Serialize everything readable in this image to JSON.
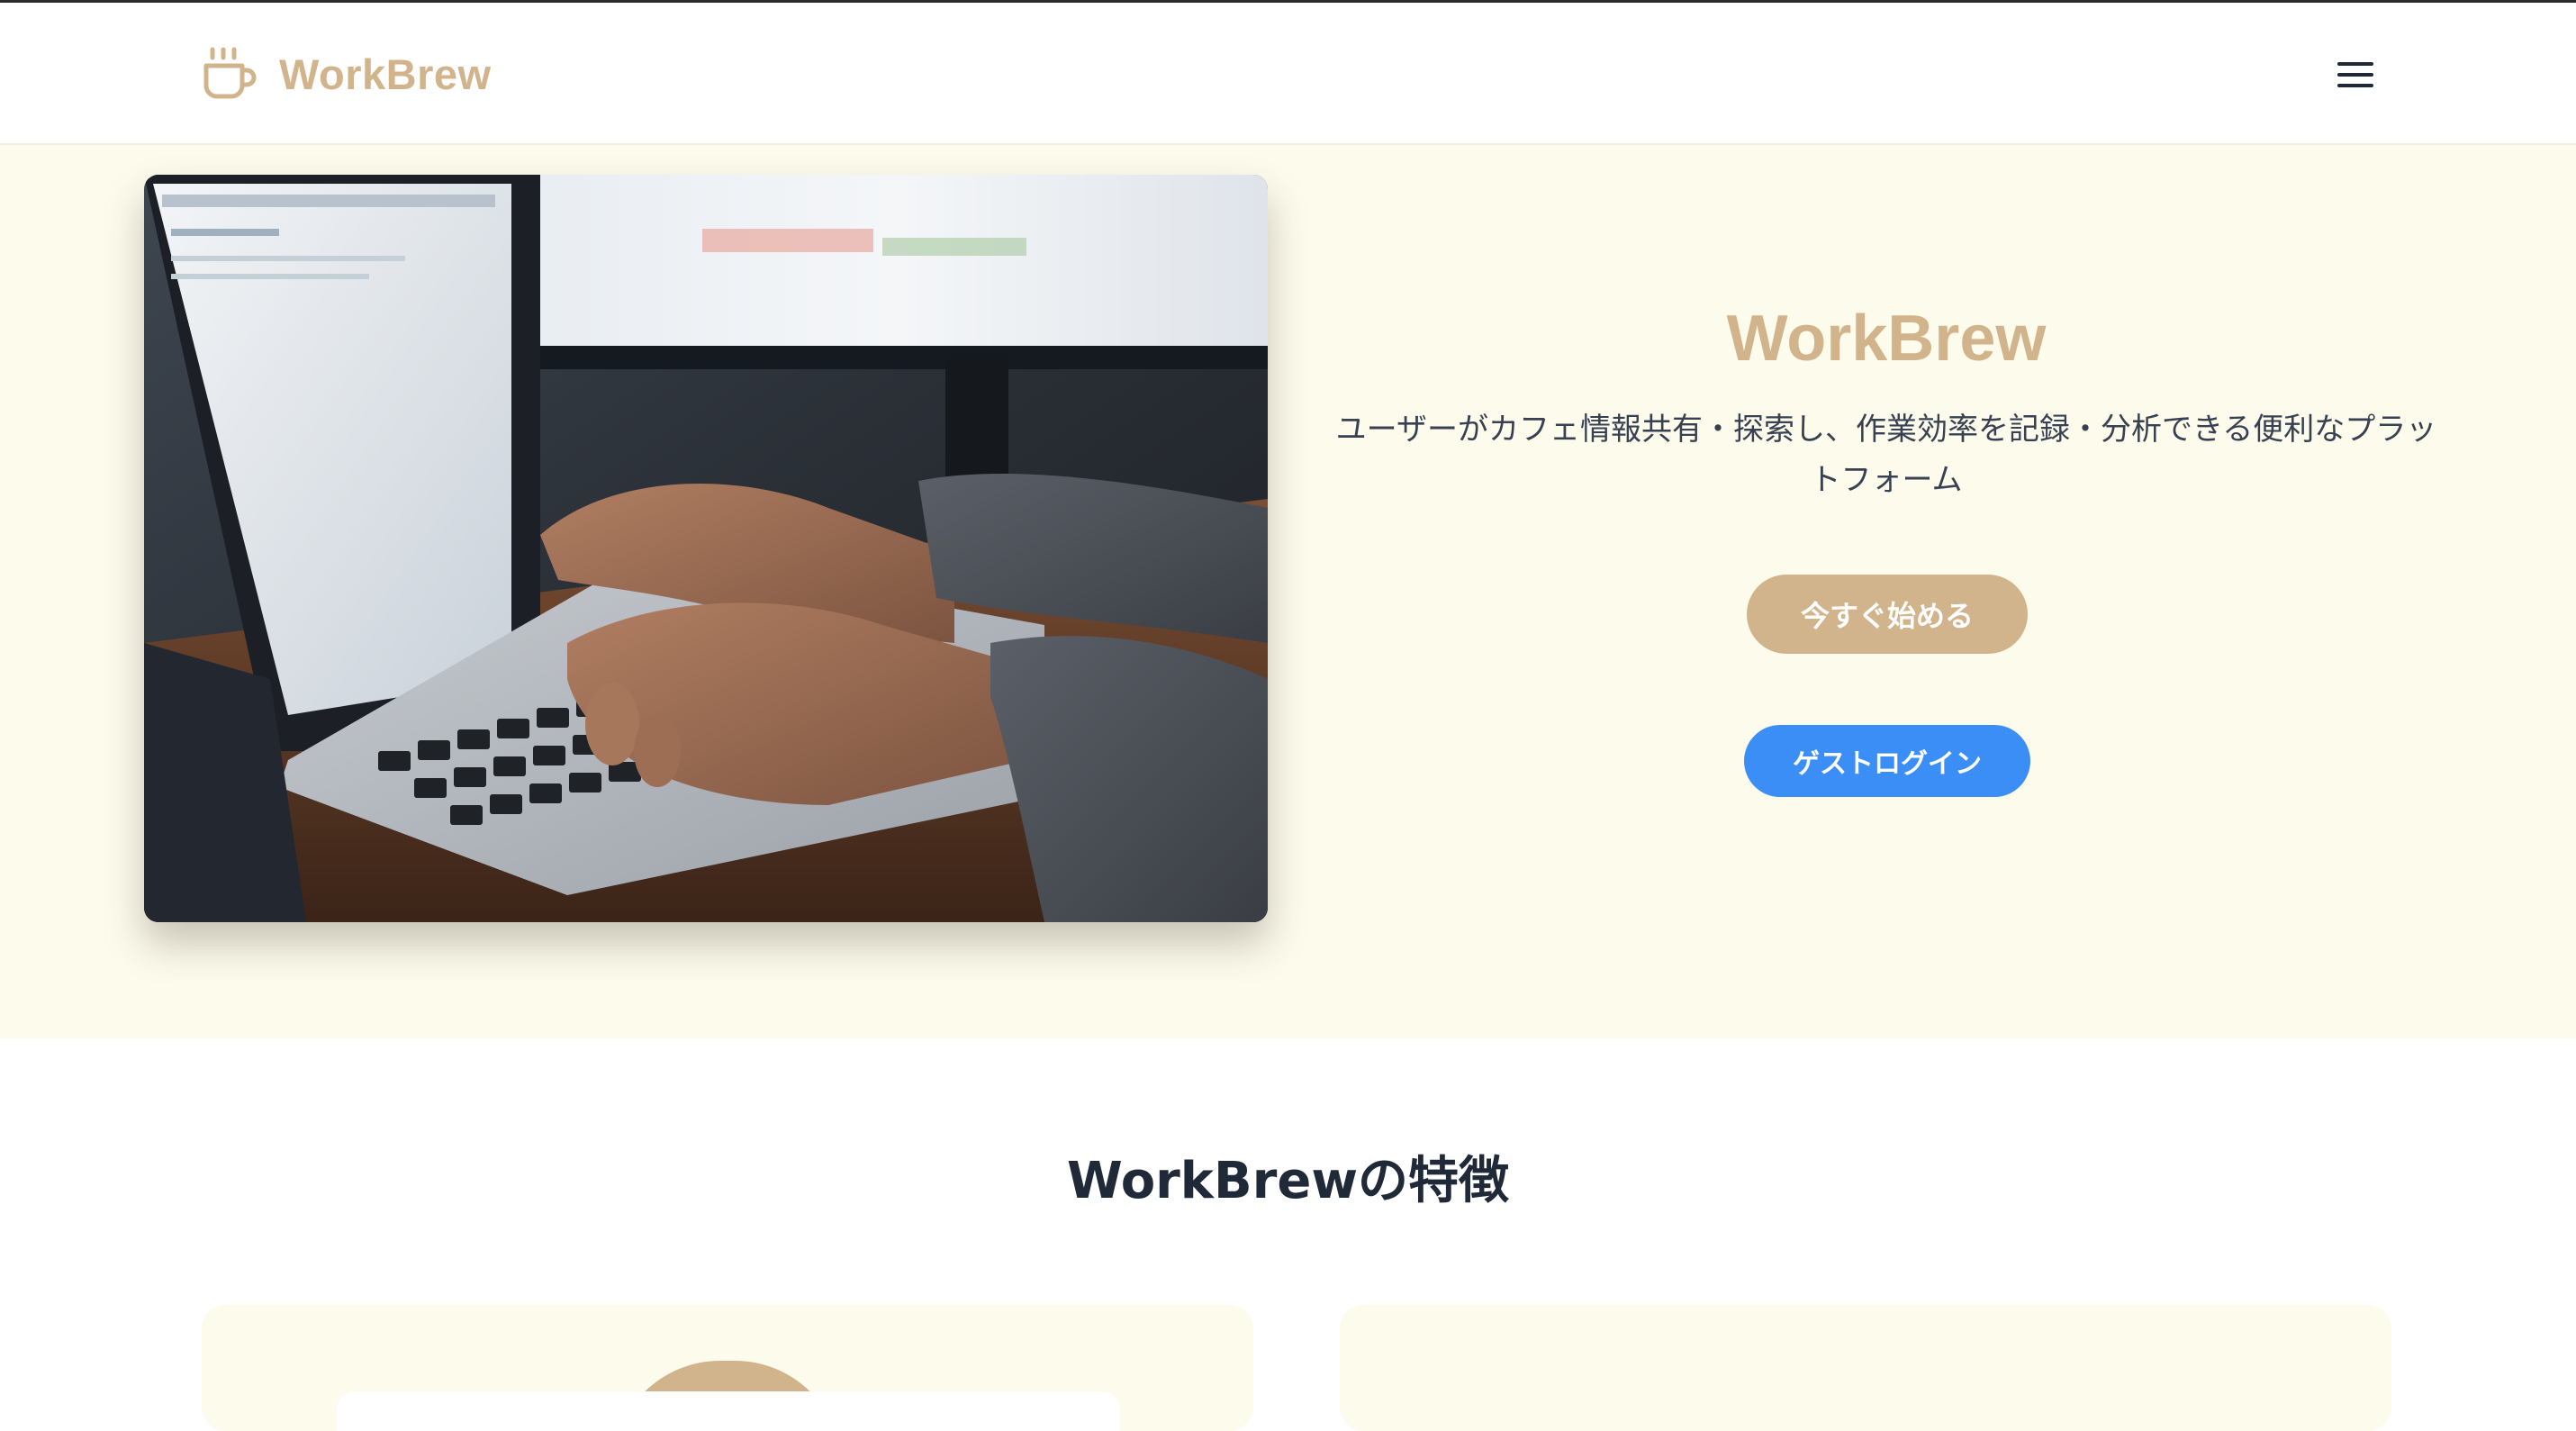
{
  "header": {
    "brand_name": "WorkBrew",
    "brand_icon": "coffee-cup-icon",
    "menu_icon": "hamburger-menu-icon"
  },
  "hero": {
    "image_description_icon": "laptop-typing-photo",
    "title": "WorkBrew",
    "description": "ユーザーがカフェ情報共有・探索し、作業効率を記録・分析できる便利なプラットフォーム",
    "start_button": "今すぐ始める",
    "guest_button": "ゲストログイン"
  },
  "features": {
    "title": "WorkBrewの特徴"
  },
  "colors": {
    "brand": "#d2b48c",
    "hero_background": "#fdfbec",
    "guest_button": "#3b8ef6",
    "text_dark": "#1f2937"
  }
}
